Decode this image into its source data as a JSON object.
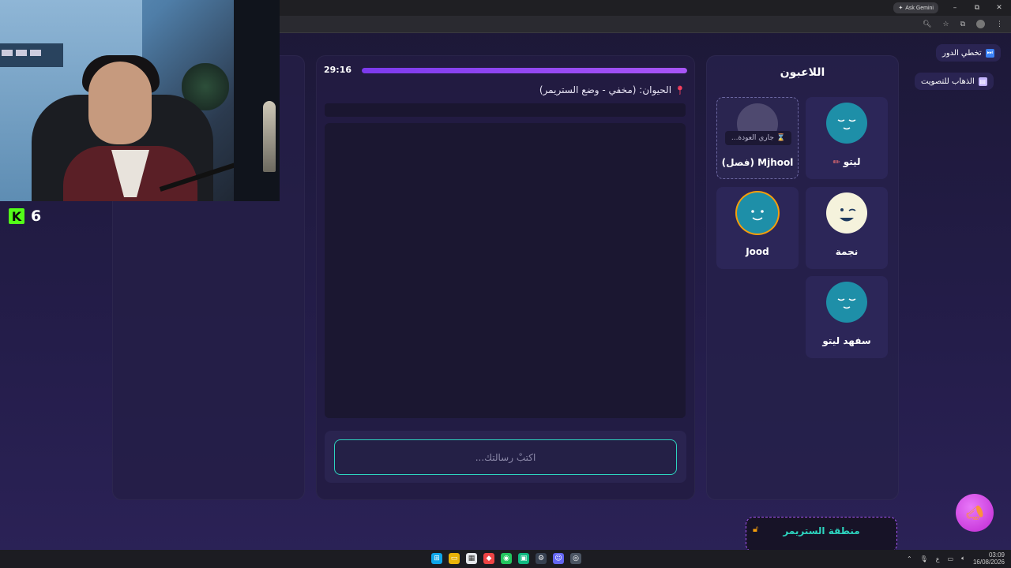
{
  "browser": {
    "ask_gemini": "Ask Gemini",
    "minimize": "–",
    "maximize": "⧉",
    "close": "✕"
  },
  "kick": {
    "viewer_count": "6",
    "logo": "K"
  },
  "game": {
    "timer": "29:16",
    "progress": 1.0,
    "animal_label": "الحيوان: (مخفي - وضع الستريمر)",
    "chat_placeholder": "اكتبْ رسالتك..."
  },
  "players": {
    "title": "اللاعبون",
    "list": [
      {
        "name": "ليتو",
        "drawing": true,
        "avatar": "teal-sleepy"
      },
      {
        "name": "Mjhool (فصل)",
        "status": "جاري العودة...",
        "avatar": "gray"
      },
      {
        "name": "نجمة",
        "avatar": "cream-wink"
      },
      {
        "name": "Jood",
        "avatar": "teal-smile-orange-ring"
      },
      {
        "name": "سفهد ليتو",
        "avatar": "teal-sleepy"
      }
    ]
  },
  "actions": {
    "skip_turn": "تخطي الدور",
    "go_vote": "الذهاب للتصويت"
  },
  "streamer_zone": {
    "title": "منطقة الستريمر"
  },
  "taskbar": {
    "time": "03:09",
    "date": "16/08/2026",
    "lang": "ع"
  },
  "colors": {
    "accent": "#a855f7",
    "input_border": "#2dd4bf",
    "kick_green": "#53fc18"
  }
}
